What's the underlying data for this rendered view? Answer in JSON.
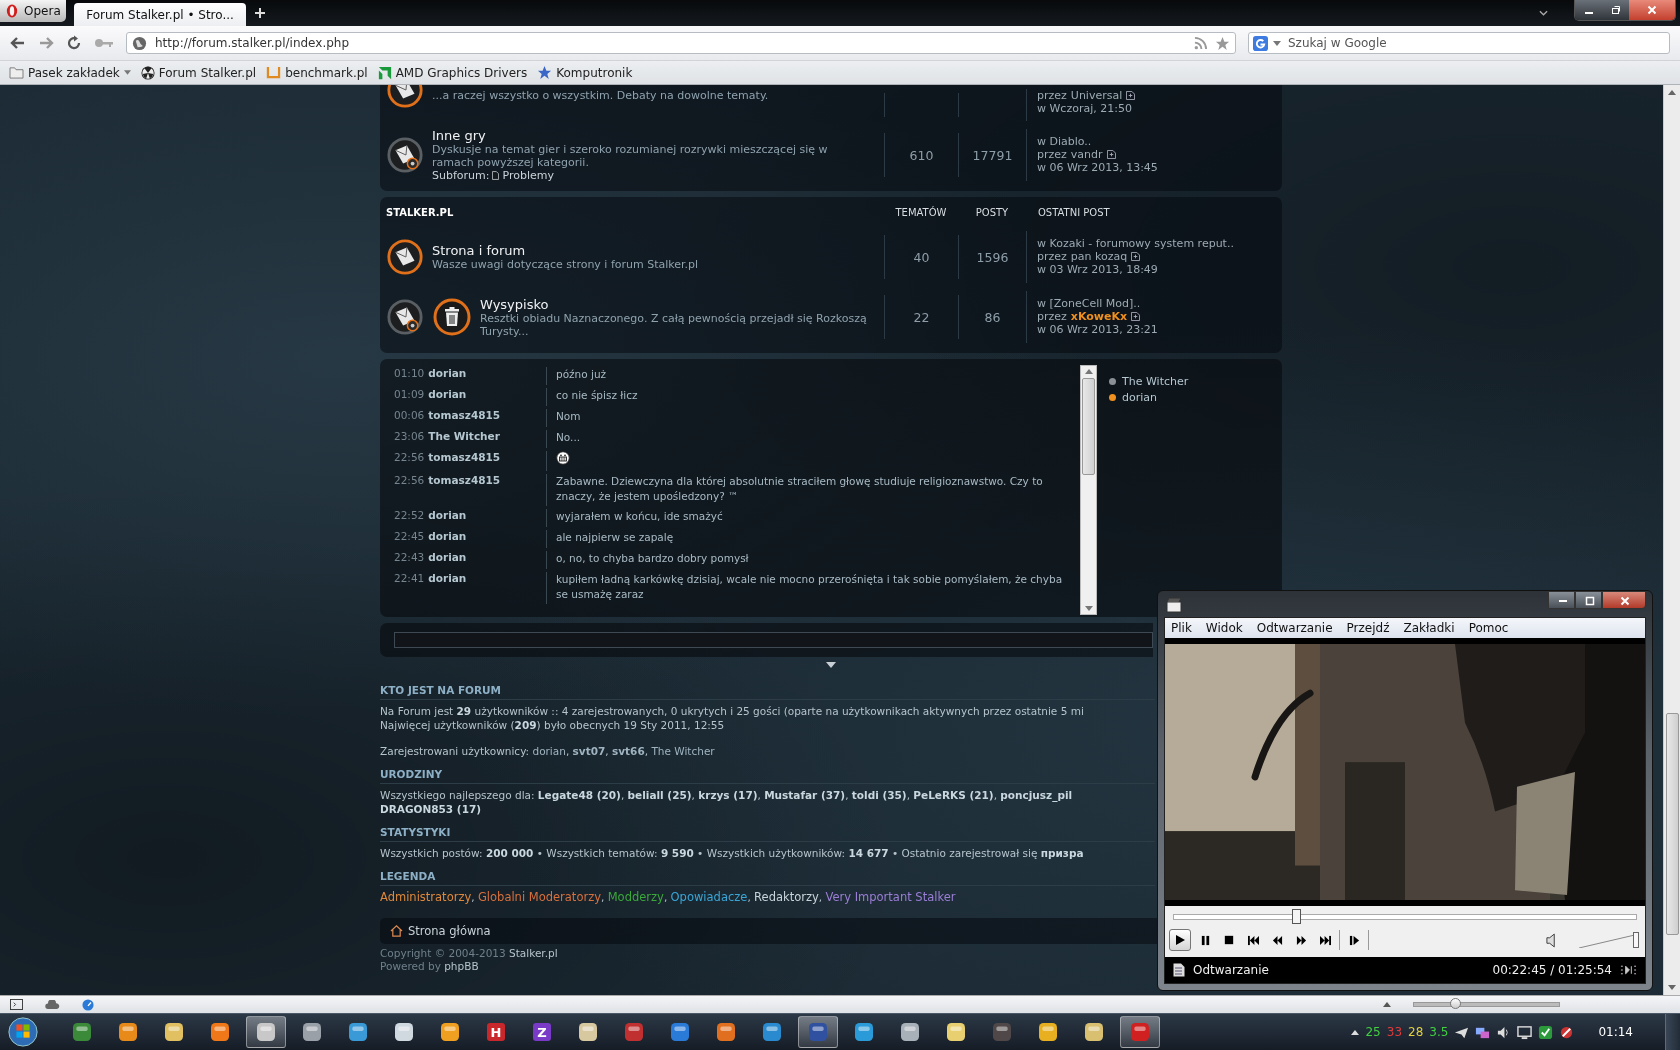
{
  "browser": {
    "menu_button": "Opera",
    "tabs": [
      {
        "title": "Forum Stalker.pl • Stro...",
        "selected": true
      }
    ],
    "address": "http://forum.stalker.pl/index.php",
    "search": {
      "placeholder": "Szukaj w Google"
    },
    "bookmarks": [
      {
        "label": "Pasek zakładek",
        "kind": "folder"
      },
      {
        "label": "Forum Stalker.pl",
        "kind": "radiation"
      },
      {
        "label": "benchmark.pl",
        "kind": "bracket"
      },
      {
        "label": "AMD Graphics Drivers",
        "kind": "amd"
      },
      {
        "label": "Komputronik",
        "kind": "star"
      }
    ],
    "zoom_slider": {
      "level": 0.28
    }
  },
  "forum": {
    "categories": [
      {
        "rows": [
          {
            "kind": "standard",
            "unread": true,
            "description": "...a raczej wszystko o wszystkim. Debaty na dowolne tematy.",
            "last_post": {
              "by": "przez",
              "author": "Universal",
              "time": "w Wczoraj, 21:50"
            }
          },
          {
            "kind": "standard",
            "unread": false,
            "title": "Inne gry",
            "description": "Dyskusje na temat gier i szeroko rozumianej rozrywki mieszczącej się w ramach powyższej kategorii.",
            "subforum": {
              "label": "Subforum:",
              "link": "Problemy"
            },
            "topics": "610",
            "posts": "17791",
            "last_post": {
              "topic": "w Diablo..",
              "by": "przez",
              "author": "vandr",
              "time": "w 06 Wrz 2013, 13:45"
            }
          }
        ]
      },
      {
        "header": {
          "name": "STALKER.PL",
          "columns": [
            "TEMATÓW",
            "POSTY",
            "OSTATNI POST"
          ]
        },
        "rows": [
          {
            "kind": "standard",
            "unread": true,
            "title": "Strona i forum",
            "description": "Wasze uwagi dotyczące strony i forum Stalker.pl",
            "topics": "40",
            "posts": "1596",
            "last_post": {
              "topic": "w Kozaki - forumowy system reput..",
              "by": "przez",
              "author": "pan kozaq",
              "time": "w 03 Wrz 2013, 18:49"
            }
          },
          {
            "kind": "custom_image",
            "unread": false,
            "title": "Wysypisko",
            "description": "Resztki obiadu Naznaczonego. Z całą pewnością przejadł się Rozkoszą Turysty...",
            "topics": "22",
            "posts": "86",
            "last_post": {
              "topic": "w [ZoneCell Mod]..",
              "by": "przez",
              "author": "xKoweKx",
              "color": "#f0901e",
              "time": "w 06 Wrz 2013, 23:21"
            }
          }
        ]
      }
    ]
  },
  "chat": {
    "messages": [
      {
        "time": "01:10",
        "user": "dorian",
        "kind": "text",
        "text": "późno już"
      },
      {
        "time": "01:09",
        "user": "dorian",
        "kind": "text",
        "text": "co nie śpisz łicz"
      },
      {
        "time": "00:06",
        "user": "tomasz4815",
        "kind": "text",
        "text": "Nom"
      },
      {
        "time": "23:06",
        "user": "The Witcher",
        "kind": "text",
        "text": "No..."
      },
      {
        "time": "22:56",
        "user": "tomasz4815",
        "kind": "emoticon"
      },
      {
        "time": "22:56",
        "user": "tomasz4815",
        "kind": "text",
        "text": "Zabawne. Dziewczyna dla której absolutnie straciłem głowę studiuje religioznawstwo. Czy to znaczy, że jestem upośledzony? ™"
      },
      {
        "time": "22:52",
        "user": "dorian",
        "kind": "text",
        "text": "wyjarałem w końcu, ide smażyć"
      },
      {
        "time": "22:45",
        "user": "dorian",
        "kind": "text",
        "text": "ale najpierw se zapalę"
      },
      {
        "time": "22:43",
        "user": "dorian",
        "kind": "text",
        "text": "o, no, to chyba bardzo dobry pomysł"
      },
      {
        "time": "22:41",
        "user": "dorian",
        "kind": "text",
        "text": "kupiłem ładną karkówkę dzisiaj, wcale nie mocno przerośnięta i tak sobie pomyślałem, że chyba se usmażę zaraz"
      }
    ],
    "online": [
      {
        "name": "The Witcher",
        "color": "#8a9096"
      },
      {
        "name": "dorian",
        "color": "#f0901e"
      }
    ]
  },
  "who_is_online": {
    "title": "KTO JEST NA FORUM",
    "lines": [
      "Na Forum jest **29** użytkowników :: 4 zarejestrowanych, 0 ukrytych i 25 gości (oparte na użytkownikach aktywnych przez ostatnie 5 mi",
      "Najwięcej użytkowników (**209**) było obecnych 19 Sty 2011, 12:55"
    ],
    "registered": {
      "label": "Zarejestrowani użytkownicy:",
      "separator": ",",
      "users": [
        {
          "name": "dorian",
          "bold": false
        },
        {
          "name": "svt07",
          "bold": true
        },
        {
          "name": "svt66",
          "bold": true
        },
        {
          "name": "The Witcher",
          "bold": false
        }
      ]
    }
  },
  "birthdays": {
    "title": "URODZINY",
    "lines": [
      "Wszystkiego najlepszego dla: **Legate48 (20)**, **beliall (25)**, **krzys (17)**, **Mustafar (37)**, **toldi (35)**, **PeLeRKS (21)**, **poncjusz_pil**",
      "**DRAGON853 (17)**"
    ]
  },
  "statistics": {
    "title": "STATYSTYKI",
    "text": "Wszystkich postów: **200 000** • Wszystkich tematów: **9 590** • Wszystkich użytkowników: **14 677** • Ostatnio zarejestrował się **призра**"
  },
  "legend": {
    "title": "LEGENDA",
    "separator": ",",
    "groups": [
      {
        "name": "Administratorzy",
        "color": "#e0883a"
      },
      {
        "name": "Globalni Moderatorzy",
        "color": "#d8703c"
      },
      {
        "name": "Modderzy",
        "color": "#3aa83a"
      },
      {
        "name": "Opowiadacze",
        "color": "#3aa6d6"
      },
      {
        "name": "Redaktorzy",
        "color": "#c8d4da"
      },
      {
        "name": "Very Important Stalker",
        "color": "#9a7ed6"
      }
    ]
  },
  "footer": {
    "home": "Strona główna",
    "copyright": "Copyright © 2004-2013",
    "copyright_link": "Stalker.pl",
    "powered": "Powered by",
    "powered_link": "phpBB"
  },
  "player": {
    "menu": [
      "Plik",
      "Widok",
      "Odtwarzanie",
      "Przejdź",
      "Zakładki",
      "Pomoc"
    ],
    "seek": {
      "level": 0.265
    },
    "volume": {
      "level": 1
    },
    "status": "Odtwarzanie",
    "time": "00:22:45 / 01:25:54"
  },
  "taskbar": {
    "items": [
      {
        "kind": "tile",
        "color": "#3a8a3a",
        "active": false
      },
      {
        "kind": "tile",
        "color": "#e88a1a",
        "active": false
      },
      {
        "kind": "tile",
        "color": "#e0c060",
        "active": false
      },
      {
        "kind": "tile",
        "color": "#f07818",
        "active": false
      },
      {
        "kind": "tile",
        "color": "#c8c8c8",
        "active": true
      },
      {
        "kind": "tile",
        "color": "#9aa0a8",
        "active": false
      },
      {
        "kind": "tile",
        "color": "#3a9ad8",
        "active": false
      },
      {
        "kind": "tile",
        "color": "#d0d8e0",
        "active": false
      },
      {
        "kind": "tile",
        "color": "#f0a020",
        "active": false
      },
      {
        "kind": "letter",
        "glyph": "H",
        "color": "#c8282c",
        "active": false
      },
      {
        "kind": "letter",
        "glyph": "Z",
        "color": "#7a3ac8",
        "active": false
      },
      {
        "kind": "tile",
        "color": "#d8c8a0",
        "active": false
      },
      {
        "kind": "tile",
        "color": "#c03030",
        "active": false
      },
      {
        "kind": "tile",
        "color": "#2a7ad8",
        "active": false
      },
      {
        "kind": "tile",
        "color": "#e07020",
        "active": false
      },
      {
        "kind": "tile",
        "color": "#2a8ad0",
        "active": false
      },
      {
        "kind": "tile",
        "color": "#3050a0",
        "active": true
      },
      {
        "kind": "tile",
        "color": "#2a9ad8",
        "active": false
      },
      {
        "kind": "tile",
        "color": "#a8b0b8",
        "active": false
      },
      {
        "kind": "tile",
        "color": "#e8d070",
        "active": false
      },
      {
        "kind": "tile",
        "color": "#504848",
        "active": false
      },
      {
        "kind": "tile",
        "color": "#e8b020",
        "active": false
      },
      {
        "kind": "tile",
        "color": "#d8c070",
        "active": false
      },
      {
        "kind": "tile",
        "color": "#d02020",
        "active": true
      }
    ],
    "tray_numbers": [
      {
        "text": "25",
        "color": "#40d040"
      },
      {
        "text": "33",
        "color": "#e03a3a"
      },
      {
        "text": "28",
        "color": "#e0d040"
      },
      {
        "text": "3.5",
        "color": "#40d040"
      }
    ],
    "clock": "01:14"
  }
}
